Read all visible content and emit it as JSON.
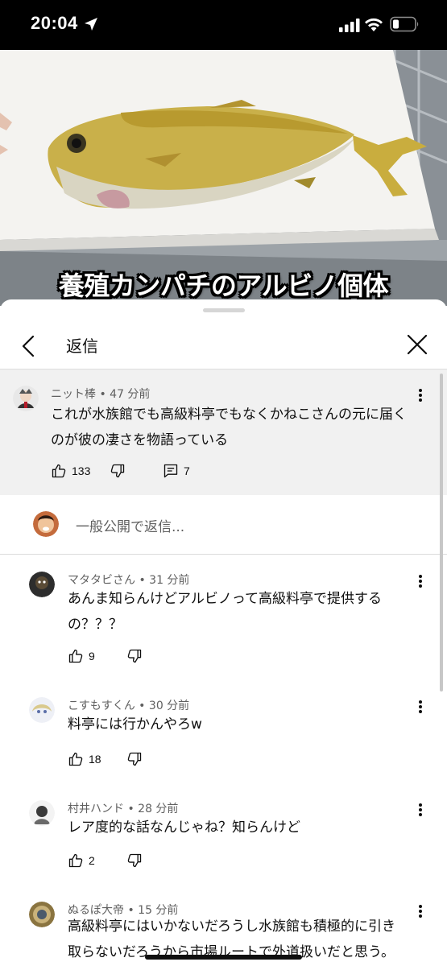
{
  "status_bar": {
    "time": "20:04"
  },
  "video": {
    "caption": "養殖カンパチのアルビノ個体"
  },
  "sheet": {
    "title": "返信"
  },
  "parent_comment": {
    "author": "ニット棒",
    "time": "47 分前",
    "text_line1": "これが水族館でも高級料亭でもなくかねこさんの元に届く",
    "text_line2": "のが彼の凄さを物語っている",
    "likes": "133",
    "replies": "7"
  },
  "reply_input": {
    "placeholder": "一般公開で返信..."
  },
  "replies": [
    {
      "author": "マタタビさん",
      "time": "31 分前",
      "text_line1": "あんま知らんけどアルビノって高級料亭で提供する",
      "text_line2": "の？？？",
      "likes": "9"
    },
    {
      "author": "こすもすくん",
      "time": "30 分前",
      "text_line1": "料亭には行かんやろw",
      "text_line2": "",
      "likes": "18"
    },
    {
      "author": "村井ハンド",
      "time": "28 分前",
      "text_line1": "レア度的な話なんじゃね？知らんけど",
      "text_line2": "",
      "likes": "2"
    },
    {
      "author": "ぬるぽ大帝",
      "time": "15 分前",
      "text_line1": "高級料亭にはいかないだろうし水族館も積極的に引き",
      "text_line2": "取らないだろうから市場ルートで外道扱いだと思う。",
      "likes": ""
    }
  ],
  "colors": {
    "meta_gray": "#606060",
    "parent_bg": "#f1f1f1",
    "divider": "#dcdcdc"
  }
}
